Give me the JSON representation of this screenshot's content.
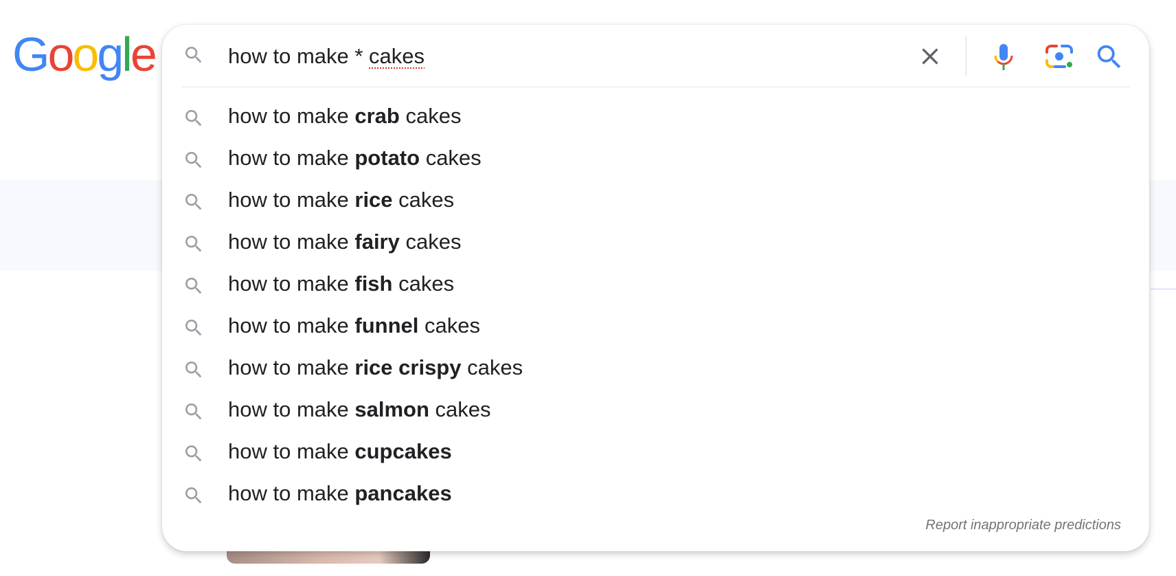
{
  "logo": {
    "letters": [
      "G",
      "o",
      "o",
      "g",
      "l",
      "e"
    ]
  },
  "search": {
    "query_prefix": "how to make * ",
    "query_misspelled": "cakes"
  },
  "suggestions": [
    {
      "prefix": "how to make ",
      "bold": "crab",
      "suffix": " cakes"
    },
    {
      "prefix": "how to make ",
      "bold": "potato",
      "suffix": " cakes"
    },
    {
      "prefix": "how to make ",
      "bold": "rice",
      "suffix": " cakes"
    },
    {
      "prefix": "how to make ",
      "bold": "fairy",
      "suffix": " cakes"
    },
    {
      "prefix": "how to make ",
      "bold": "fish",
      "suffix": " cakes"
    },
    {
      "prefix": "how to make ",
      "bold": "funnel",
      "suffix": " cakes"
    },
    {
      "prefix": "how to make ",
      "bold": "rice crispy",
      "suffix": " cakes"
    },
    {
      "prefix": "how to make ",
      "bold": "salmon",
      "suffix": " cakes"
    },
    {
      "prefix": "how to make ",
      "bold": "cupcakes",
      "suffix": ""
    },
    {
      "prefix": "how to make ",
      "bold": "pancakes",
      "suffix": ""
    }
  ],
  "footer": {
    "report_label": "Report inappropriate predictions"
  },
  "colors": {
    "blue": "#4285F4",
    "red": "#EA4335",
    "yellow": "#FBBC05",
    "green": "#34A853",
    "icon_gray": "#9aa0a6"
  },
  "icons": [
    "search-icon",
    "close-icon",
    "microphone-icon",
    "lens-camera-icon",
    "search-submit-icon"
  ]
}
